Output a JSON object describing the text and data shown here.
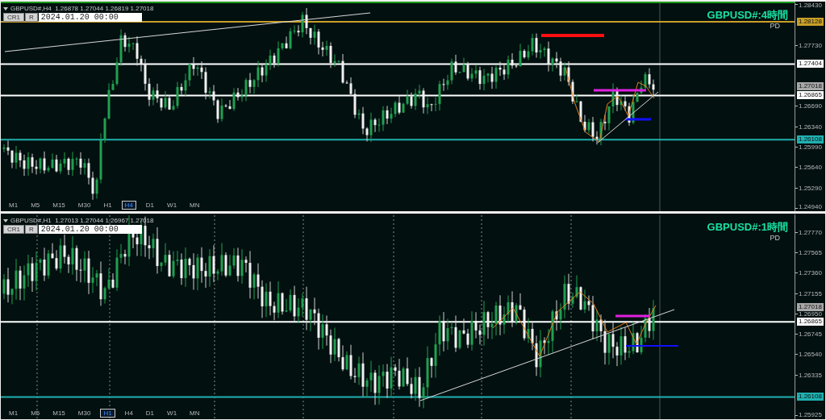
{
  "panels": [
    {
      "active": true,
      "header": "GBPUSD#,H4  1.26878 1.27044 1.26819 1.27018",
      "buttons": [
        "CR1",
        "R"
      ],
      "date": "2024.01.20 00:00",
      "title": "GBPUSD#:4時間",
      "subtitle": "PD",
      "ticks": [
        "1.28430",
        "1.27730",
        "1.26690",
        "1.26340",
        "1.25990",
        "1.25640",
        "1.25290",
        "1.24940"
      ],
      "levels": [
        {
          "price": "1.28128",
          "kind": "line",
          "color": "#c8a028"
        },
        {
          "price": "1.27404",
          "kind": "line",
          "color": "#ffffff"
        },
        {
          "price": "1.27018",
          "kind": "tag",
          "color": "#a8a8a8"
        },
        {
          "price": "1.26865",
          "kind": "line",
          "color": "#ffffff"
        },
        {
          "price": "1.26108",
          "kind": "line",
          "color": "#20b0b0"
        }
      ],
      "timeframes": [
        {
          "label": "M1",
          "selected": false
        },
        {
          "label": "M5",
          "selected": false
        },
        {
          "label": "M15",
          "selected": false
        },
        {
          "label": "M30",
          "selected": false
        },
        {
          "label": "H1",
          "selected": false
        },
        {
          "label": "H4",
          "selected": true
        },
        {
          "label": "D1",
          "selected": false
        },
        {
          "label": "W1",
          "selected": false
        },
        {
          "label": "MN",
          "selected": false
        }
      ]
    },
    {
      "active": false,
      "header": "GBPUSD#,H1  1.27013 1.27044 1.26967 1.27018",
      "buttons": [
        "CR1",
        "R"
      ],
      "date": "2024.01.20 00:00",
      "title": "GBPUSD#:1時間",
      "subtitle": "PD",
      "ticks": [
        "1.27770",
        "1.27565",
        "1.27360",
        "1.27155",
        "1.26950",
        "1.26745",
        "1.26540",
        "1.26335",
        "1.25925"
      ],
      "levels": [
        {
          "price": "1.27018",
          "kind": "tag",
          "color": "#a8a8a8"
        },
        {
          "price": "1.26865",
          "kind": "line",
          "color": "#ffffff"
        },
        {
          "price": "1.26108",
          "kind": "line",
          "color": "#20b0b0"
        }
      ],
      "timeframes": [
        {
          "label": "M1",
          "selected": false
        },
        {
          "label": "M5",
          "selected": false
        },
        {
          "label": "M15",
          "selected": false
        },
        {
          "label": "M30",
          "selected": false
        },
        {
          "label": "H1",
          "selected": true
        },
        {
          "label": "H4",
          "selected": false
        },
        {
          "label": "D1",
          "selected": false
        },
        {
          "label": "W1",
          "selected": false
        },
        {
          "label": "MN",
          "selected": false
        }
      ]
    }
  ]
}
